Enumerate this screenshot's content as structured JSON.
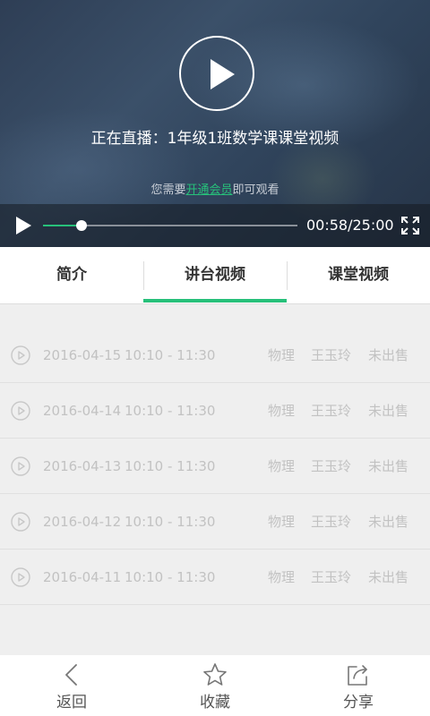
{
  "player": {
    "live_title": "正在直播：1年级1班数学课课堂视频",
    "member_tip_prefix": "您需要",
    "member_link": "开通会员",
    "member_tip_suffix": "即可观看",
    "time_display": "00:58/25:00",
    "progress_fraction": 0.15,
    "accent_color": "#27c07a"
  },
  "tabs": [
    {
      "label": "简介",
      "active": false
    },
    {
      "label": "讲台视频",
      "active": true
    },
    {
      "label": "课堂视频",
      "active": false
    }
  ],
  "sessions": [
    {
      "date": "2016-04-15",
      "time": "10:10 - 11:30",
      "subject": "物理",
      "teacher": "王玉玲",
      "status": "未出售"
    },
    {
      "date": "2016-04-14",
      "time": "10:10 - 11:30",
      "subject": "物理",
      "teacher": "王玉玲",
      "status": "未出售"
    },
    {
      "date": "2016-04-13",
      "time": "10:10 - 11:30",
      "subject": "物理",
      "teacher": "王玉玲",
      "status": "未出售"
    },
    {
      "date": "2016-04-12",
      "time": "10:10 - 11:30",
      "subject": "物理",
      "teacher": "王玉玲",
      "status": "未出售"
    },
    {
      "date": "2016-04-11",
      "time": "10:10 - 11:30",
      "subject": "物理",
      "teacher": "王玉玲",
      "status": "未出售"
    }
  ],
  "bottom_bar": {
    "back_label": "返回",
    "favorite_label": "收藏",
    "share_label": "分享",
    "back_icon": "chevron-left-icon",
    "favorite_icon": "star-icon",
    "share_icon": "share-icon"
  }
}
